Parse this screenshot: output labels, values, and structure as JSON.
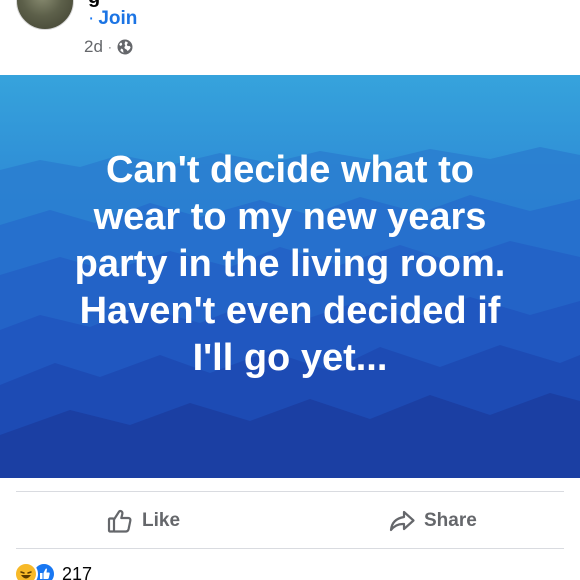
{
  "header": {
    "author_name": "g",
    "join_separator": "·",
    "join_label": "Join",
    "time": "2d",
    "meta_separator": "·",
    "privacy_icon": "globe-icon"
  },
  "post": {
    "text": "Can't decide what to\nwear to my new years\nparty in the living room.\nHaven't even decided if\nI'll go yet...",
    "background_colors": [
      "#2f9ad6",
      "#2561c8",
      "#1b3898"
    ]
  },
  "actions": {
    "like_label": "Like",
    "like_icon": "thumbs-up-icon",
    "share_label": "Share",
    "share_icon": "share-arrow-icon"
  },
  "reactions": {
    "icons": [
      "haha-icon",
      "like-icon"
    ],
    "count": "217"
  },
  "colors": {
    "brand_blue": "#1b74e4",
    "muted_text": "#65676b"
  }
}
